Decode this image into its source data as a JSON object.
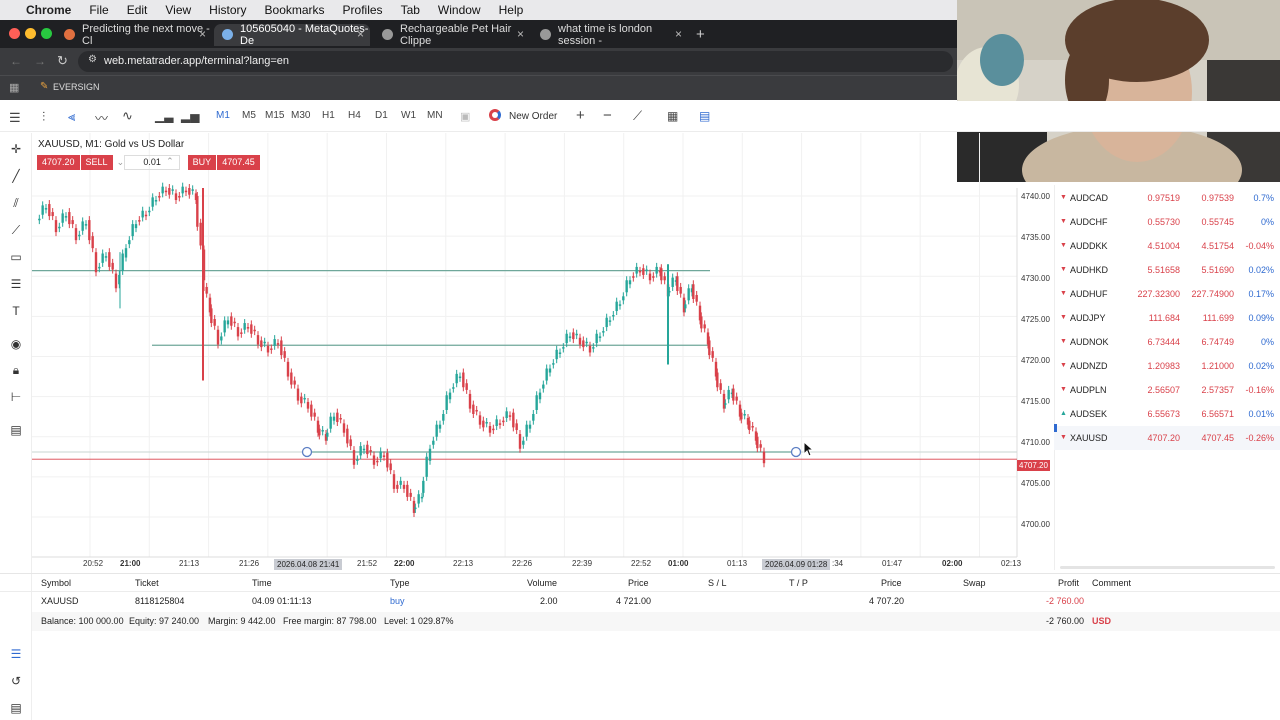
{
  "menubar": {
    "app": "Chrome",
    "items": [
      "File",
      "Edit",
      "View",
      "History",
      "Bookmarks",
      "Profiles",
      "Tab",
      "Window",
      "Help"
    ]
  },
  "tabs": [
    {
      "title": "Predicting the next move - Cl",
      "active": false
    },
    {
      "title": "105605040 - MetaQuotes-De",
      "active": true
    },
    {
      "title": "Rechargeable Pet Hair Clippe",
      "active": false
    },
    {
      "title": "what time is london session -",
      "active": false
    }
  ],
  "address": {
    "url": "web.metatrader.app/terminal?lang=en"
  },
  "bookmark": {
    "label": "EVERSIGN"
  },
  "toolbar": {
    "timeframes": [
      "M1",
      "M5",
      "M15",
      "M30",
      "H1",
      "H4",
      "D1",
      "W1",
      "MN"
    ],
    "active_timeframe": "M1",
    "new_order": "New Order"
  },
  "chart": {
    "title": "XAUUSD, M1: Gold vs US Dollar",
    "sell_price": "4707.20",
    "sell_label": "SELL",
    "volume": "0.01",
    "buy_label": "BUY",
    "buy_price": "4707.45",
    "current_price_label": "4707.20",
    "price_ticks": [
      "4740.00",
      "4735.00",
      "4730.00",
      "4725.00",
      "4720.00",
      "4715.00",
      "4710.00",
      "4705.00",
      "4700.00"
    ],
    "time_ticks": [
      "20:52",
      "21:00",
      "21:13",
      "21:26",
      "2026.04.08 21:41",
      "21:52",
      "22:00",
      "22:13",
      "22:26",
      "22:39",
      "22:52",
      "01:00",
      "01:13",
      "2026.04.09 01:28",
      ":34",
      "01:47",
      "02:00",
      "02:13"
    ]
  },
  "chart_data": {
    "type": "candlestick",
    "title": "XAUUSD, M1: Gold vs US Dollar",
    "ylim": [
      4698,
      4741
    ],
    "current_price": 4707.2,
    "horizontal_lines": [
      4730.7,
      4721.4,
      4708.1,
      4707.2
    ],
    "trend_line": {
      "from_price": 4708.1,
      "to_price": 4708.1
    }
  },
  "watchlist": [
    {
      "symbol": "AUDCAD",
      "bid": "0.97519",
      "ask": "0.97539",
      "change": "0.7%",
      "dir": "down"
    },
    {
      "symbol": "AUDCHF",
      "bid": "0.55730",
      "ask": "0.55745",
      "change": "0%",
      "dir": "down"
    },
    {
      "symbol": "AUDDKK",
      "bid": "4.51004",
      "ask": "4.51754",
      "change": "-0.04%",
      "dir": "down"
    },
    {
      "symbol": "AUDHKD",
      "bid": "5.51658",
      "ask": "5.51690",
      "change": "0.02%",
      "dir": "down"
    },
    {
      "symbol": "AUDHUF",
      "bid": "227.32300",
      "ask": "227.74900",
      "change": "0.17%",
      "dir": "down"
    },
    {
      "symbol": "AUDJPY",
      "bid": "111.684",
      "ask": "111.699",
      "change": "0.09%",
      "dir": "down"
    },
    {
      "symbol": "AUDNOK",
      "bid": "6.73444",
      "ask": "6.74749",
      "change": "0%",
      "dir": "down"
    },
    {
      "symbol": "AUDNZD",
      "bid": "1.20983",
      "ask": "1.21000",
      "change": "0.02%",
      "dir": "down"
    },
    {
      "symbol": "AUDPLN",
      "bid": "2.56507",
      "ask": "2.57357",
      "change": "-0.16%",
      "dir": "down"
    },
    {
      "symbol": "AUDSEK",
      "bid": "6.55673",
      "ask": "6.56571",
      "change": "0.01%",
      "dir": "up"
    },
    {
      "symbol": "XAUUSD",
      "bid": "4707.20",
      "ask": "4707.45",
      "change": "-0.26%",
      "dir": "down"
    }
  ],
  "positions": {
    "headers": [
      "Symbol",
      "Ticket",
      "Time",
      "Type",
      "Volume",
      "Price",
      "S / L",
      "T / P",
      "Price",
      "Swap",
      "Profit",
      "Comment"
    ],
    "row": {
      "symbol": "XAUUSD",
      "ticket": "8118125804",
      "time": "04.09 01:11:13",
      "type": "buy",
      "volume": "2.00",
      "open_price": "4 721.00",
      "price": "4 707.20",
      "profit": "-2 760.00"
    },
    "balance": "Balance: 100 000.00",
    "equity": "Equity: 97 240.00",
    "margin": "Margin: 9 442.00",
    "free_margin": "Free margin: 87 798.00",
    "level": "Level: 1 029.87%",
    "total_profit": "-2 760.00",
    "currency": "USD"
  },
  "colors": {
    "down": "#d9414a",
    "up": "#26a69a",
    "accent": "#2f6ad0"
  }
}
